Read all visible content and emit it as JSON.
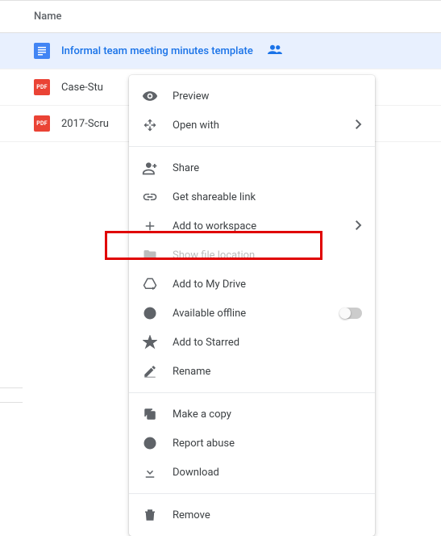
{
  "header": {
    "name_col": "Name"
  },
  "files": [
    {
      "name": "Informal team meeting minutes template"
    },
    {
      "name": "Case-Stu"
    },
    {
      "name": "2017-Scru"
    }
  ],
  "menu": {
    "preview": "Preview",
    "open_with": "Open with",
    "share": "Share",
    "get_link": "Get shareable link",
    "add_workspace": "Add to workspace",
    "show_location": "Show file location",
    "add_drive": "Add to My Drive",
    "available_offline": "Available offline",
    "add_starred": "Add to Starred",
    "rename": "Rename",
    "make_copy": "Make a copy",
    "report_abuse": "Report abuse",
    "download": "Download",
    "remove": "Remove"
  }
}
